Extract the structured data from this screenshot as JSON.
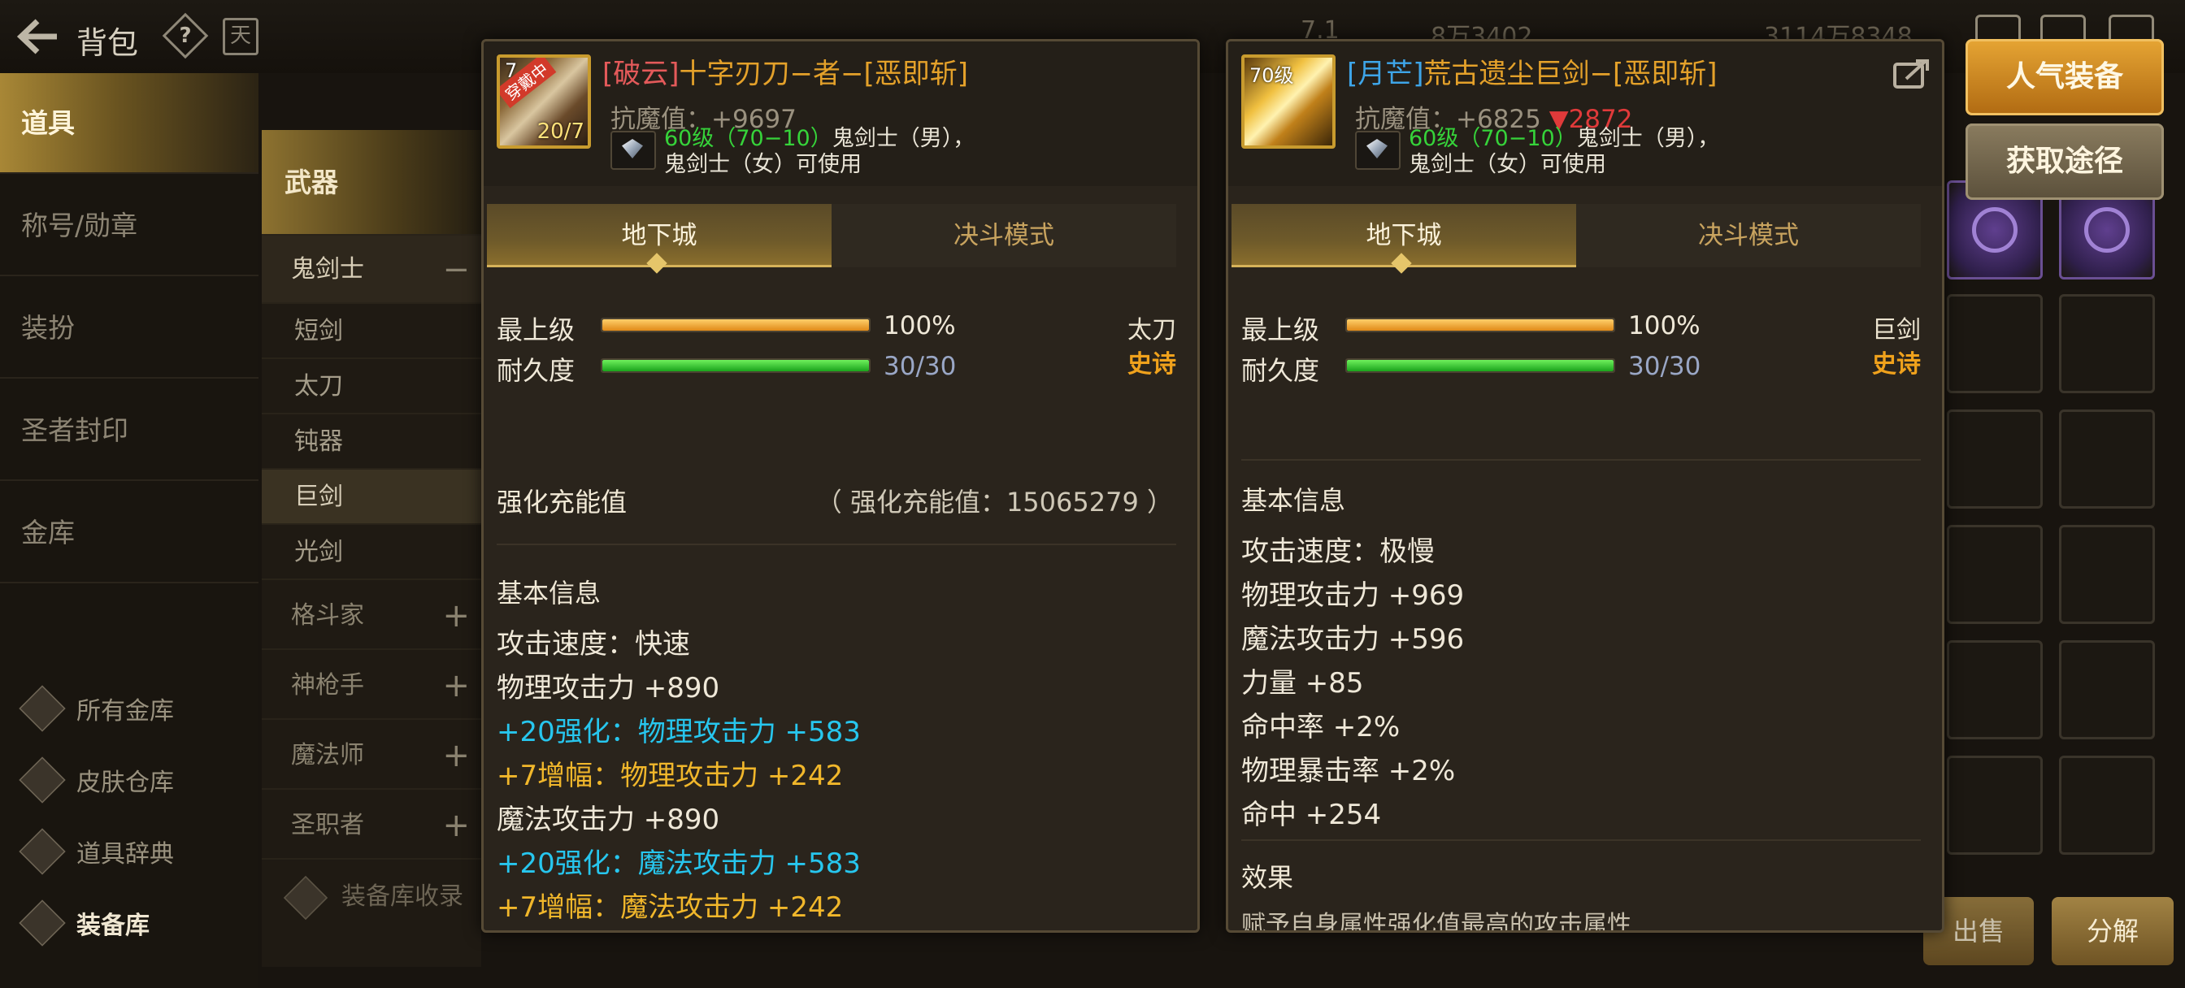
{
  "topbar": {
    "title": "背包",
    "help_glyph": "?",
    "calendar_glyph": "天",
    "faded_1": "7.1",
    "faded_2": "8万3402",
    "faded_3": "3114万8348"
  },
  "leftnav": {
    "items": [
      {
        "label": "道具",
        "active": true
      },
      {
        "label": "称号/勋章"
      },
      {
        "label": "装扮"
      },
      {
        "label": "圣者封印"
      },
      {
        "label": "金库"
      }
    ],
    "bottom": [
      {
        "label": "所有金库",
        "icon": "vault-icon"
      },
      {
        "label": "皮肤仓库",
        "icon": "skin-warehouse-icon"
      },
      {
        "label": "道具辞典",
        "icon": "item-dictionary-icon"
      },
      {
        "label": "装备库",
        "icon": "equipment-library-icon",
        "active": true
      }
    ]
  },
  "midnav": {
    "header": "武器",
    "classes": [
      {
        "label": "鬼剑士",
        "toggle": "−",
        "open": true
      },
      {
        "label": "格斗家",
        "toggle": "+"
      },
      {
        "label": "神枪手",
        "toggle": "+"
      },
      {
        "label": "魔法师",
        "toggle": "+"
      },
      {
        "label": "圣职者",
        "toggle": "+"
      }
    ],
    "subs": [
      {
        "label": "短剑"
      },
      {
        "label": "太刀"
      },
      {
        "label": "钝器"
      },
      {
        "label": "巨剑",
        "selected": true
      },
      {
        "label": "光剑"
      }
    ],
    "collect": "装备库收录"
  },
  "side_buttons": {
    "popular": "人气装备",
    "source": "获取途径",
    "sell": "出售",
    "decompose": "分解"
  },
  "panel_a": {
    "icon": {
      "level": "7",
      "wearing": "穿戴中",
      "count": "20/7"
    },
    "tag": "[破云]",
    "name": "十字刃刀−者−[恶即斩]",
    "kangmo": "抗魔值：+9697",
    "req_level": "60级（70−10）",
    "req_line1_suffix": "鬼剑士（男），",
    "req_line2": "鬼剑士（女）可使用",
    "tabs": {
      "dungeon": "地下城",
      "pvp": "决斗模式"
    },
    "grade_label": "最上级",
    "grade_value": "100%",
    "grade_fill": 1.0,
    "durability_label": "耐久度",
    "durability_value": "30/30",
    "durability_fill": 1.0,
    "weapon_type": "太刀",
    "rarity": "史诗",
    "charge_title": "强化充能值",
    "charge_value": "（ 强化充能值：15065279 ）",
    "basic_title": "基本信息",
    "stats": [
      {
        "text": "攻击速度：快速",
        "kind": "normal"
      },
      {
        "text": "物理攻击力 +890",
        "kind": "normal"
      },
      {
        "text": "+20强化：物理攻击力 +583",
        "kind": "cyan"
      },
      {
        "text": " +7增幅：物理攻击力 +242",
        "kind": "gold"
      },
      {
        "text": "魔法攻击力 +890",
        "kind": "normal"
      },
      {
        "text": "+20强化：魔法攻击力 +583",
        "kind": "cyan"
      },
      {
        "text": " +7增幅：魔法攻击力 +242",
        "kind": "gold"
      }
    ]
  },
  "panel_b": {
    "icon": {
      "level": "70级"
    },
    "tag": "[月芒]",
    "name": "荒古遗尘巨剑−[恶即斩]",
    "kangmo": "抗魔值：+6825 ",
    "kangmo_down": "▼2872",
    "req_level": "60级（70−10）",
    "req_line1_suffix": "鬼剑士（男），",
    "req_line2": "鬼剑士（女）可使用",
    "tabs": {
      "dungeon": "地下城",
      "pvp": "决斗模式"
    },
    "grade_label": "最上级",
    "grade_value": "100%",
    "grade_fill": 1.0,
    "durability_label": "耐久度",
    "durability_value": "30/30",
    "durability_fill": 1.0,
    "weapon_type": "巨剑",
    "rarity": "史诗",
    "basic_title": "基本信息",
    "stats": [
      {
        "text": "攻击速度：极慢",
        "kind": "normal"
      },
      {
        "text": "物理攻击力 +969",
        "kind": "normal"
      },
      {
        "text": "魔法攻击力 +596",
        "kind": "normal"
      },
      {
        "text": "力量 +85",
        "kind": "normal"
      },
      {
        "text": "命中率 +2%",
        "kind": "normal"
      },
      {
        "text": "物理暴击率 +2%",
        "kind": "normal"
      },
      {
        "text": "命中 +254",
        "kind": "normal"
      }
    ],
    "effect_title": "效果",
    "effect_text": "赋予自身属性强化值最高的攻击属性"
  }
}
